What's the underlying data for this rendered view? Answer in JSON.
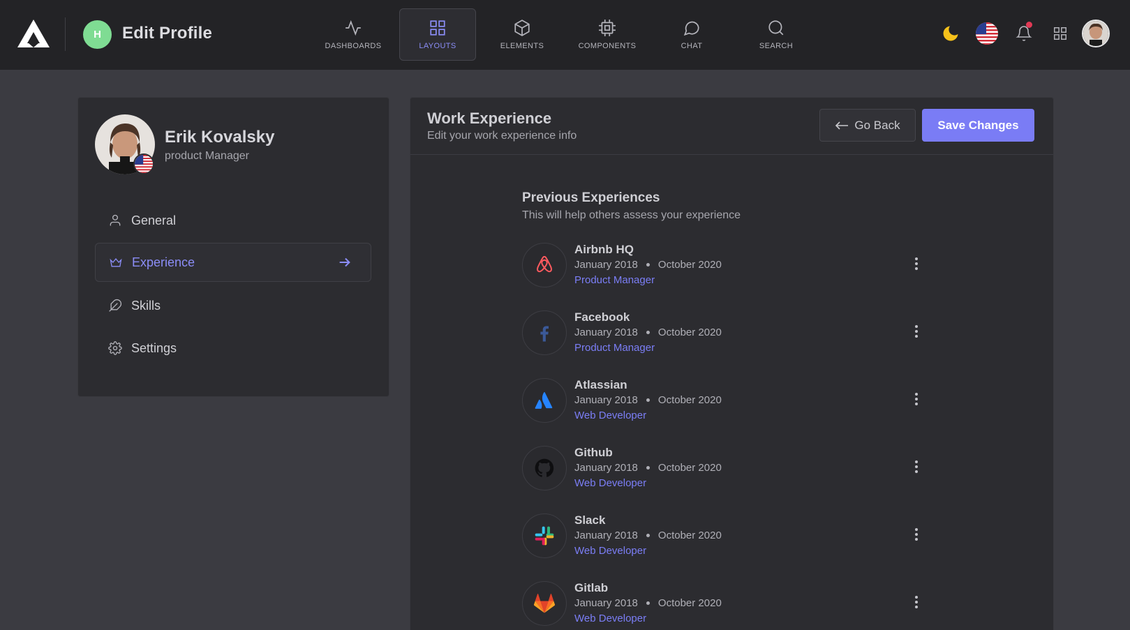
{
  "header": {
    "title": "Edit Profile",
    "page_avatar_letter": "H",
    "nav": [
      {
        "label": "DASHBOARDS",
        "icon": "activity-icon"
      },
      {
        "label": "LAYOUTS",
        "icon": "grid-icon",
        "active": true
      },
      {
        "label": "ELEMENTS",
        "icon": "box-icon"
      },
      {
        "label": "COMPONENTS",
        "icon": "cpu-icon"
      },
      {
        "label": "CHAT",
        "icon": "chat-icon"
      },
      {
        "label": "SEARCH",
        "icon": "search-icon"
      }
    ],
    "right_icons": [
      "moon-icon",
      "us-flag-icon",
      "bell-icon",
      "apps-grid-icon",
      "user-avatar"
    ]
  },
  "profile": {
    "name": "Erik Kovalsky",
    "role": "product Manager",
    "menu": [
      {
        "label": "General",
        "icon": "user-icon"
      },
      {
        "label": "Experience",
        "icon": "crown-icon",
        "active": true
      },
      {
        "label": "Skills",
        "icon": "feather-icon"
      },
      {
        "label": "Settings",
        "icon": "gear-icon"
      }
    ]
  },
  "main": {
    "title": "Work Experience",
    "subtitle": "Edit your work experience info",
    "back_label": "Go Back",
    "save_label": "Save Changes",
    "section_title": "Previous Experiences",
    "section_subtitle": "This will help others assess your experience",
    "experiences": [
      {
        "company": "Airbnb HQ",
        "start": "January 2018",
        "end": "October 2020",
        "position": "Product Manager",
        "icon": "airbnb-icon"
      },
      {
        "company": "Facebook",
        "start": "January 2018",
        "end": "October 2020",
        "position": "Product Manager",
        "icon": "facebook-icon"
      },
      {
        "company": "Atlassian",
        "start": "January 2018",
        "end": "October 2020",
        "position": "Web Developer",
        "icon": "atlassian-icon"
      },
      {
        "company": "Github",
        "start": "January 2018",
        "end": "October 2020",
        "position": "Web Developer",
        "icon": "github-icon"
      },
      {
        "company": "Slack",
        "start": "January 2018",
        "end": "October 2020",
        "position": "Web Developer",
        "icon": "slack-icon"
      },
      {
        "company": "Gitlab",
        "start": "January 2018",
        "end": "October 2020",
        "position": "Web Developer",
        "icon": "gitlab-icon"
      }
    ]
  },
  "colors": {
    "accent": "#7a7cf5",
    "topbar": "#232326",
    "background": "#3b3b41",
    "card": "#2c2c30"
  }
}
